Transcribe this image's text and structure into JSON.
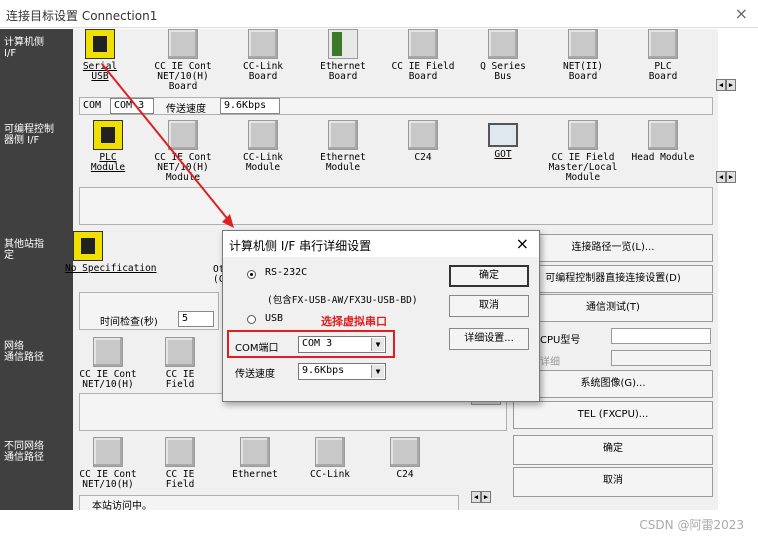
{
  "window": {
    "title": "连接目标设置 Connection1",
    "close": "×"
  },
  "left_labels": {
    "pc_if": "计算机侧\nI/F",
    "plc_if": "可编程控制\n器侧 I/F",
    "other_station": "其他站指\n定",
    "network": "网络\n通信路径",
    "diff_network": "不同网络\n通信路径"
  },
  "pc_if": {
    "items": [
      "Serial\nUSB",
      "CC IE Cont\nNET/10(H)\nBoard",
      "CC-Link\nBoard",
      "Ethernet\nBoard",
      "CC IE Field\nBoard",
      "Q Series\nBus",
      "NET(II)\nBoard",
      "PLC\nBoard"
    ],
    "strip": {
      "com_label": "COM",
      "com_value": "COM 3",
      "speed_label": "传送速度",
      "speed_value": "9.6Kbps"
    }
  },
  "plc_if": {
    "items": [
      "PLC\nModule",
      "CC IE Cont\nNET/10(H)\nModule",
      "CC-Link\nModule",
      "Ethernet\nModule",
      "C24",
      "GOT",
      "CC IE Field\nMaster/Local\nModule",
      "Head Module"
    ]
  },
  "other_station": {
    "item": "No Specification",
    "partial": "Ot\n(C",
    "check_time_label": "时间检查(秒)",
    "check_time_value": "5"
  },
  "network": {
    "items": [
      "CC IE Cont\nNET/10(H)",
      "CC IE\nField"
    ]
  },
  "diff_network": {
    "items": [
      "CC IE Cont\nNET/10(H)",
      "CC IE\nField",
      "Ethernet",
      "CC-Link",
      "C24"
    ],
    "status": "本站访问中。"
  },
  "right_buttons": {
    "path_list": "连接路径一览(L)...",
    "direct_plc": "可编程控制器直接连接设置(D)",
    "comm_test": "通信测试(T)",
    "cpu_type_label": "CPU型号",
    "detail_label": "详细",
    "system_image": "系统图像(G)...",
    "tel": "TEL (FXCPU)...",
    "ok": "确定",
    "cancel": "取消"
  },
  "dialog": {
    "title": "计算机侧 I/F 串行详细设置",
    "close": "×",
    "rs232c": "RS-232C",
    "rs232c_note": "(包含FX-USB-AW/FX3U-USB-BD)",
    "usb": "USB",
    "annotation": "选择虚拟串口",
    "com_label": "COM端口",
    "com_value": "COM 3",
    "speed_label": "传送速度",
    "speed_value": "9.6Kbps",
    "ok": "确定",
    "cancel": "取消",
    "detail": "详细设置..."
  },
  "watermark": "CSDN @阿雷2023",
  "colors": {
    "left_column": "#404040",
    "annotation": "#e02020",
    "selected_icon": "#f0e000"
  }
}
